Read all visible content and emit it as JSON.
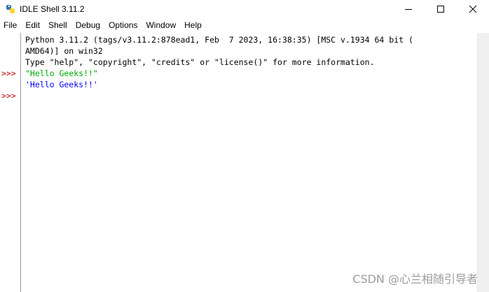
{
  "window": {
    "title": "IDLE Shell 3.11.2",
    "icon": "python-icon",
    "controls": [
      "minimize-icon",
      "maximize-icon",
      "close-icon"
    ]
  },
  "menu": {
    "items": [
      "File",
      "Edit",
      "Shell",
      "Debug",
      "Options",
      "Window",
      "Help"
    ]
  },
  "shell": {
    "banner": [
      "Python 3.11.2 (tags/v3.11.2:878ead1, Feb  7 2023, 16:38:35) [MSC v.1934 64 bit (",
      "AMD64)] on win32",
      "Type \"help\", \"copyright\", \"credits\" or \"license()\" for more information."
    ],
    "prompt": ">>>",
    "input": "\"Hello Geeks!!\"",
    "output": "'Hello Geeks!!'",
    "colors": {
      "prompt": "#c00000",
      "string_input": "#00aa00",
      "output": "#0000ff"
    }
  },
  "watermark": "CSDN @心兰相随引导者"
}
